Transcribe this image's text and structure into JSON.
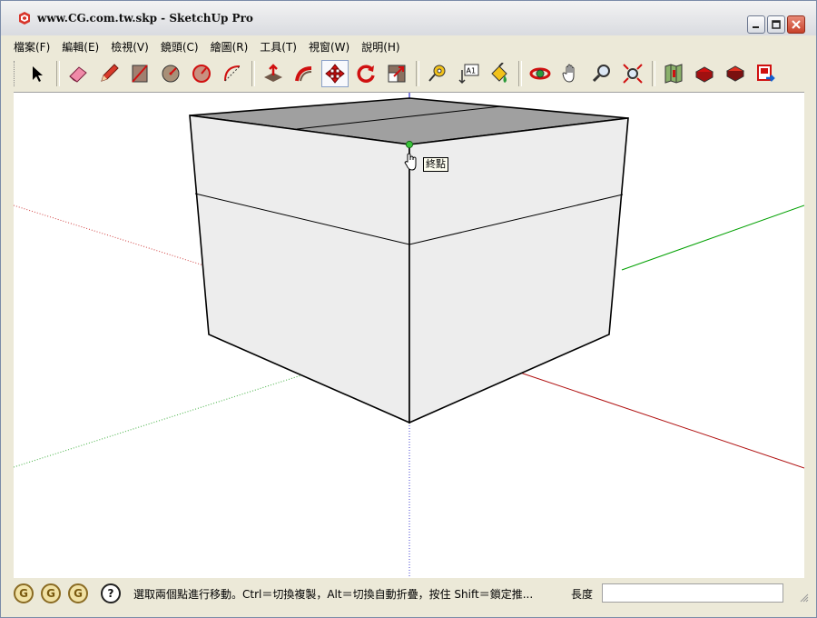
{
  "window": {
    "title": "www.CG.com.tw.skp - SketchUp Pro",
    "buttons": [
      "minimize",
      "maximize",
      "close"
    ]
  },
  "menu": [
    {
      "label": "檔案(F)"
    },
    {
      "label": "編輯(E)"
    },
    {
      "label": "檢視(V)"
    },
    {
      "label": "鏡頭(C)"
    },
    {
      "label": "繪圖(R)"
    },
    {
      "label": "工具(T)"
    },
    {
      "label": "視窗(W)"
    },
    {
      "label": "說明(H)"
    }
  ],
  "toolbar": {
    "tools": [
      {
        "name": "select-tool",
        "icon": "arrow-cursor-icon"
      },
      {
        "name": "eraser-tool",
        "icon": "eraser-icon"
      },
      {
        "name": "pencil-tool",
        "icon": "pencil-icon"
      },
      {
        "name": "rectangle-tool",
        "icon": "rectangle-icon"
      },
      {
        "name": "circle-tool",
        "icon": "circle-icon"
      },
      {
        "name": "polygon-tool",
        "icon": "polygon-icon"
      },
      {
        "name": "arc-tool",
        "icon": "arc-icon"
      },
      {
        "name": "push-pull-tool",
        "icon": "push-pull-icon"
      },
      {
        "name": "follow-me-tool",
        "icon": "follow-me-icon"
      },
      {
        "name": "move-tool",
        "icon": "move-icon"
      },
      {
        "name": "rotate-tool",
        "icon": "rotate-icon"
      },
      {
        "name": "scale-tool",
        "icon": "scale-icon"
      },
      {
        "name": "tape-measure-tool",
        "icon": "tape-measure-icon"
      },
      {
        "name": "text-tool",
        "icon": "text-label-icon"
      },
      {
        "name": "paint-bucket-tool",
        "icon": "paint-bucket-icon"
      },
      {
        "name": "orbit-tool",
        "icon": "orbit-icon"
      },
      {
        "name": "pan-tool",
        "icon": "hand-icon"
      },
      {
        "name": "zoom-tool",
        "icon": "magnifier-icon"
      },
      {
        "name": "zoom-extents-tool",
        "icon": "zoom-extents-icon"
      },
      {
        "name": "get-models-tool",
        "icon": "map-icon"
      },
      {
        "name": "share-model-tool",
        "icon": "share-model-icon"
      },
      {
        "name": "components-tool",
        "icon": "components-icon"
      },
      {
        "name": "send-to-layout-tool",
        "icon": "send-to-layout-icon"
      }
    ],
    "active": "move-tool",
    "text_tool_glyph": "A1"
  },
  "viewport": {
    "inference_tooltip": "終點",
    "axis_colors": {
      "red": "#b01010",
      "green": "#00a000",
      "blue": "#0000c0"
    },
    "face_colors": {
      "top": "#a0a0a0",
      "side": "#ededed"
    }
  },
  "status": {
    "icons": [
      "G",
      "G",
      "G"
    ],
    "help_glyph": "?",
    "message": "選取兩個點進行移動。Ctrl＝切換複製，Alt＝切換自動折疊，按住 Shift＝鎖定推...",
    "measure_label": "長度",
    "measure_value": ""
  }
}
